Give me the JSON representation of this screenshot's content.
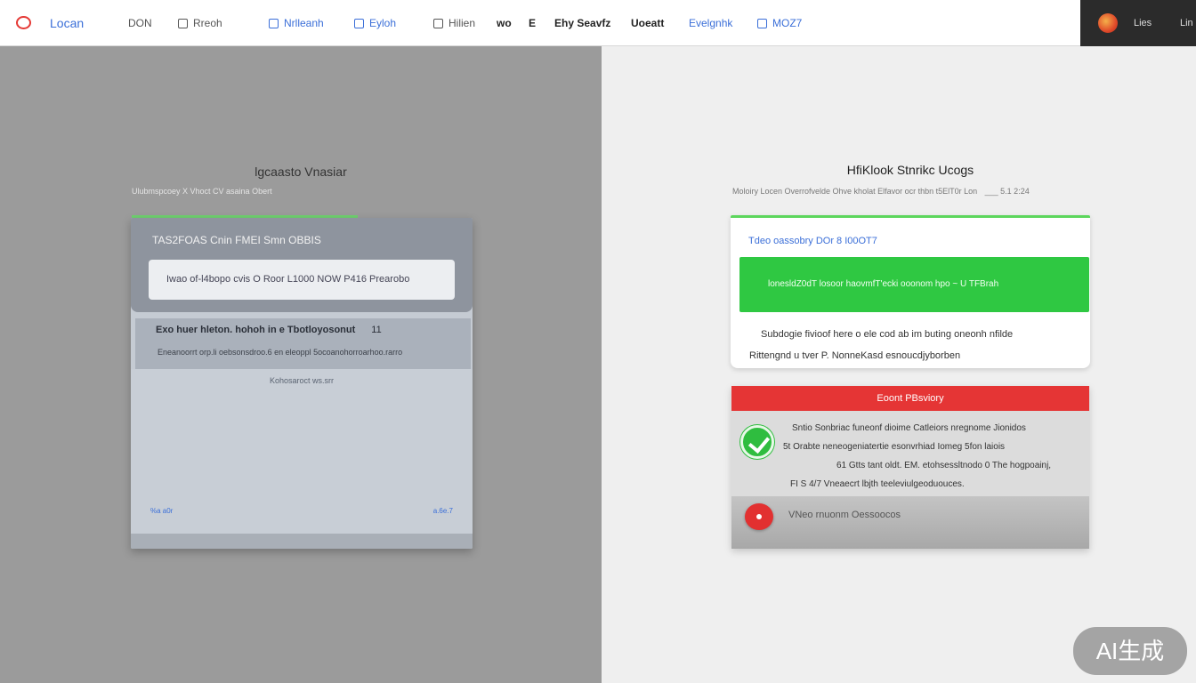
{
  "nav": {
    "logo": "Locan",
    "items": [
      {
        "label": "DON",
        "style": "gray",
        "icon": false
      },
      {
        "label": "Rreoh",
        "style": "gray",
        "icon": true
      },
      {
        "label": "Nrlleanh",
        "style": "blue",
        "icon": true
      },
      {
        "label": "Eyloh",
        "style": "blue",
        "icon": true
      },
      {
        "label": "Hilien",
        "style": "gray",
        "icon": true
      },
      {
        "label": "wo",
        "style": "dark",
        "icon": false
      },
      {
        "label": "E",
        "style": "dark",
        "icon": false
      },
      {
        "label": "Ehy Seavfz",
        "style": "dark",
        "icon": false
      },
      {
        "label": "Uoeatt",
        "style": "dark",
        "icon": false
      },
      {
        "label": "Evelgnhk",
        "style": "blue",
        "icon": false
      },
      {
        "label": "MOZ7",
        "style": "blue",
        "icon": true
      }
    ],
    "user_name": "Lies",
    "user_extra": "Lin"
  },
  "left": {
    "title": "lgcaasto Vnasiar",
    "subtitle": "Ulubmspcoey X Vhoct CV asaina Obert",
    "card_title": "TAS2FOAS Cnin FMEI Smn OBBIS",
    "input_value": "Iwao of-l4bopo cvis O Roor  L1000 NOW P416  Prearobo",
    "row_title": "Exo huer  hleton. hohoh in e  Tbotloyosonut",
    "row_badge": "11",
    "row_sub": "Eneanoorrt  orp.li oebsonsdroo.6 en eleoppl 5ocoanohorroarhoo.rarro",
    "center_text": "Kohosaroct ws.srr",
    "foot_left": "%a a0r",
    "foot_right": "a.6e.7"
  },
  "right": {
    "title": "HfiKlook Stnrikc Ucogs",
    "subtitle": "Moloiry Locen   Overrofvelde Ohve kholat Elfavor ocr thbn t5ElT0r Lon",
    "subtitle_extra": "___   5.1 2:24",
    "card_title": "Tdeo oassobry DOr  8  I00OT7",
    "green_text": "lonesldZ0dT losoor haovmfT'ecki ooonom hpo  ~  U TFBrah",
    "line1": "Subdogie fivioof here o ele cod ab im buting oneonh nfilde",
    "line2": "Rittengnd u tver P.  NonneKasd esnoucdjyborben",
    "alert_header": "Eoont PBsviory",
    "alert_lines": [
      "Sntio Sonbriac funeonf dioime Catleiors nregnome Jionidos",
      "5t Orabte neneogeniatertie esonvrhiad  Iomeg 5fon laiois",
      "61 Gtts tant oldt. EM. etohsessltnodo 0 The hogpoainj,",
      "FI S 4/7 Vneaecrt lbjth teeleviulgeoduouces."
    ],
    "alert_footer": "VNeo rnuonm Oessoocos"
  },
  "watermark": "AI生成",
  "colors": {
    "accent_blue": "#3b6fd8",
    "success_green": "#2fc842",
    "alert_red": "#e53535",
    "user_bar": "#2b2b2b"
  },
  "icons": {
    "logo": "ring-logo-icon",
    "success": "check-circle-icon",
    "record": "record-dot-icon"
  }
}
